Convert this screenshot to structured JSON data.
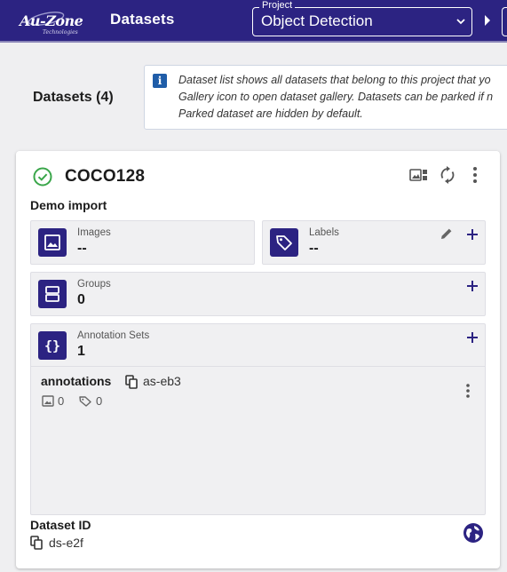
{
  "brand": {
    "logo_text": "Au-Zone",
    "logo_subtext": "Technologies"
  },
  "app": {
    "title": "Datasets"
  },
  "project": {
    "legend": "Project",
    "value": "Object Detection"
  },
  "page": {
    "heading": "Datasets (4)",
    "info_lines": [
      "Dataset list shows all datasets that belong to this project that yo",
      "Gallery icon to open dataset gallery. Datasets can be parked if n",
      "Parked dataset are hidden by default."
    ]
  },
  "dataset": {
    "name": "COCO128",
    "description": "Demo import",
    "images": {
      "label": "Images",
      "value": "--"
    },
    "labels": {
      "label": "Labels",
      "value": "--"
    },
    "groups": {
      "label": "Groups",
      "value": "0"
    },
    "annotation_sets": {
      "label": "Annotation Sets",
      "value": "1",
      "items": [
        {
          "name": "annotations",
          "id": "as-eb3",
          "image_count": "0",
          "label_count": "0"
        }
      ]
    },
    "id_label": "Dataset ID",
    "id_value": "ds-e2f"
  },
  "colors": {
    "primary": "#2c2382",
    "status_ok": "#3aa64a",
    "info": "#1f5da8"
  },
  "icons": [
    "chevron-down-icon",
    "chevron-right-icon",
    "info-icon",
    "check-circle-icon",
    "gallery-icon",
    "sync-icon",
    "more-vert-icon",
    "image-icon",
    "tag-icon",
    "pencil-icon",
    "plus-icon",
    "groups-icon",
    "braces-icon",
    "copy-icon",
    "globe-icon"
  ]
}
